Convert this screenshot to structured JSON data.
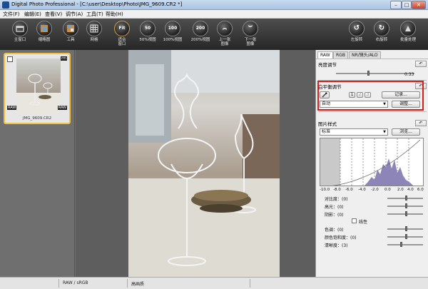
{
  "window": {
    "title": "Digital Photo Professional - [C:\\user\\Desktop\\Photo\\JMG_9609.CR2 *]",
    "buttons": {
      "minimize": "–",
      "maximize": "□",
      "close": "✕"
    }
  },
  "menu": [
    "文件(F)",
    "编辑(E)",
    "查看(V)",
    "调节(A)",
    "工具(T)",
    "帮助(H)"
  ],
  "toolbar": [
    {
      "label": "主窗口",
      "icon": "home-icon",
      "text": ""
    },
    {
      "label": "缩略图",
      "icon": "thumbnail-icon",
      "text": ""
    },
    {
      "label": "工具",
      "icon": "toolbox-icon",
      "text": ""
    },
    {
      "label": "网格",
      "icon": "grid-icon",
      "text": ""
    },
    {
      "label": "适合\n窗口",
      "icon": "fit-window-icon",
      "text": "Fit"
    },
    {
      "label": "50%视图",
      "icon": "zoom-50-icon",
      "text": "50"
    },
    {
      "label": "100%视图",
      "icon": "zoom-100-icon",
      "text": "100"
    },
    {
      "label": "200%视图",
      "icon": "zoom-200-icon",
      "text": "200"
    },
    {
      "label": "上一张\n图像",
      "icon": "chevron-up-icon",
      "text": "︽"
    },
    {
      "label": "下一张\n图像",
      "icon": "chevron-down-icon",
      "text": "︾"
    },
    {
      "label": "左旋转",
      "icon": "rotate-left-icon",
      "text": "↺"
    },
    {
      "label": "右旋转",
      "icon": "rotate-right-icon",
      "text": "↻"
    },
    {
      "label": "批量处理",
      "icon": "batch-icon",
      "text": ""
    }
  ],
  "thumbnail": {
    "filename": "JMG_9609.CR2",
    "badge_top": "rm",
    "badge_left": "RAW",
    "badge_right": "RAW"
  },
  "panel": {
    "tabs": [
      "RAW",
      "RGB",
      "NR/镜头/ALO"
    ],
    "brightness": {
      "title": "亮度调节",
      "value": "0.33",
      "undo": "↶"
    },
    "white_balance": {
      "title": "白平衡调节",
      "undo": "↶",
      "slots": [
        "1",
        "2",
        "3"
      ],
      "record_button": "记录...",
      "mode": "自动",
      "adjust_button": "调整..."
    },
    "picture_style": {
      "title": "图片样式",
      "undo": "↶",
      "style": "标准",
      "browse_button": "浏览...",
      "axis": [
        "-10.0",
        "-8.0",
        "-6.0",
        "-4.0",
        "-2.0",
        "0.0",
        "2.0",
        "4.0",
        "6.0"
      ],
      "contrast": "对比度：(0)",
      "highlight": "高光：(0)",
      "shadow": "阴影：(0)",
      "linear": "线性",
      "tone": "色调：(0)",
      "saturation": "颜色饱和度：(0)",
      "sharpness": "清晰度：(3)"
    }
  },
  "status": {
    "color": "RAW / sRGB",
    "quality": "高画质"
  }
}
